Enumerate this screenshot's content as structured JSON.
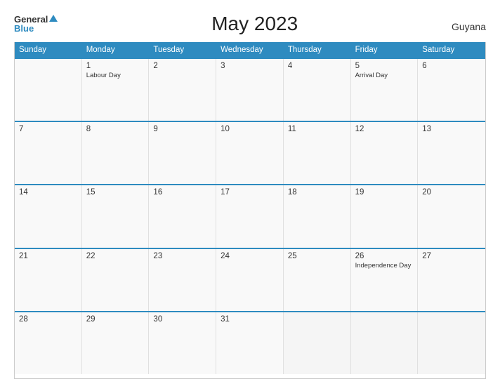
{
  "header": {
    "logo_general": "General",
    "logo_blue": "Blue",
    "title": "May 2023",
    "country": "Guyana"
  },
  "days_of_week": [
    "Sunday",
    "Monday",
    "Tuesday",
    "Wednesday",
    "Thursday",
    "Friday",
    "Saturday"
  ],
  "weeks": [
    [
      {
        "num": "",
        "holiday": ""
      },
      {
        "num": "1",
        "holiday": "Labour Day"
      },
      {
        "num": "2",
        "holiday": ""
      },
      {
        "num": "3",
        "holiday": ""
      },
      {
        "num": "4",
        "holiday": ""
      },
      {
        "num": "5",
        "holiday": "Arrival Day"
      },
      {
        "num": "6",
        "holiday": ""
      }
    ],
    [
      {
        "num": "7",
        "holiday": ""
      },
      {
        "num": "8",
        "holiday": ""
      },
      {
        "num": "9",
        "holiday": ""
      },
      {
        "num": "10",
        "holiday": ""
      },
      {
        "num": "11",
        "holiday": ""
      },
      {
        "num": "12",
        "holiday": ""
      },
      {
        "num": "13",
        "holiday": ""
      }
    ],
    [
      {
        "num": "14",
        "holiday": ""
      },
      {
        "num": "15",
        "holiday": ""
      },
      {
        "num": "16",
        "holiday": ""
      },
      {
        "num": "17",
        "holiday": ""
      },
      {
        "num": "18",
        "holiday": ""
      },
      {
        "num": "19",
        "holiday": ""
      },
      {
        "num": "20",
        "holiday": ""
      }
    ],
    [
      {
        "num": "21",
        "holiday": ""
      },
      {
        "num": "22",
        "holiday": ""
      },
      {
        "num": "23",
        "holiday": ""
      },
      {
        "num": "24",
        "holiday": ""
      },
      {
        "num": "25",
        "holiday": ""
      },
      {
        "num": "26",
        "holiday": "Independence Day"
      },
      {
        "num": "27",
        "holiday": ""
      }
    ],
    [
      {
        "num": "28",
        "holiday": ""
      },
      {
        "num": "29",
        "holiday": ""
      },
      {
        "num": "30",
        "holiday": ""
      },
      {
        "num": "31",
        "holiday": ""
      },
      {
        "num": "",
        "holiday": ""
      },
      {
        "num": "",
        "holiday": ""
      },
      {
        "num": "",
        "holiday": ""
      }
    ]
  ]
}
